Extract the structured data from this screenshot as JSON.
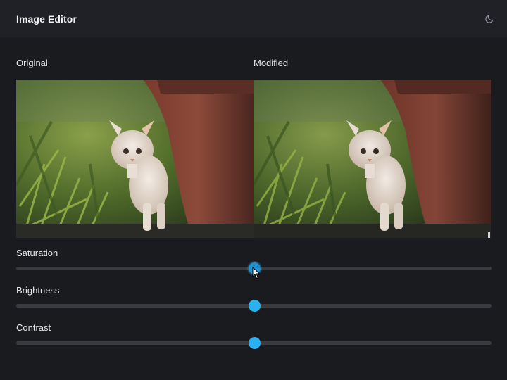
{
  "header": {
    "title": "Image Editor",
    "theme_icon": "moon-icon"
  },
  "panels": {
    "original_label": "Original",
    "modified_label": "Modified"
  },
  "sliders": [
    {
      "label": "Saturation",
      "value": 0.5
    },
    {
      "label": "Brightness",
      "value": 0.5
    },
    {
      "label": "Contrast",
      "value": 0.5
    }
  ],
  "colors": {
    "accent": "#29b1f0",
    "background": "#1a1b1f",
    "header": "#202127",
    "track": "#3a3b40"
  }
}
